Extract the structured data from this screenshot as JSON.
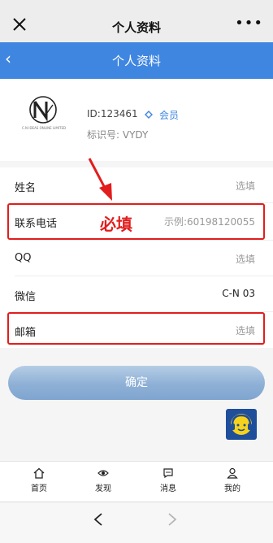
{
  "wechat": {
    "title": "个人资料",
    "more": "•••"
  },
  "header": {
    "title": "个人资料"
  },
  "profile": {
    "logo_text": "C.N IDEAS ONLINE LIMITED",
    "user_id": "ID:123461",
    "member_label": "会员",
    "id_number": "标识号: VYDY"
  },
  "annotation": "必填",
  "form": {
    "rows": [
      {
        "label": "姓名",
        "value": "选填"
      },
      {
        "label": "联系电话",
        "value": "示例:60198120055"
      },
      {
        "label": "QQ",
        "value": "选填"
      },
      {
        "label": "微信",
        "value": "C-N 03"
      },
      {
        "label": "邮箱",
        "value": "选填"
      }
    ]
  },
  "confirm_label": "确定",
  "tabs": [
    {
      "label": "首页",
      "icon": "home-icon"
    },
    {
      "label": "发现",
      "icon": "eye-icon"
    },
    {
      "label": "消息",
      "icon": "chat-icon"
    },
    {
      "label": "我的",
      "icon": "user-icon"
    }
  ],
  "colors": {
    "accent": "#3f86e0",
    "highlight": "#e21d1d",
    "button": "#8eb0d6"
  }
}
